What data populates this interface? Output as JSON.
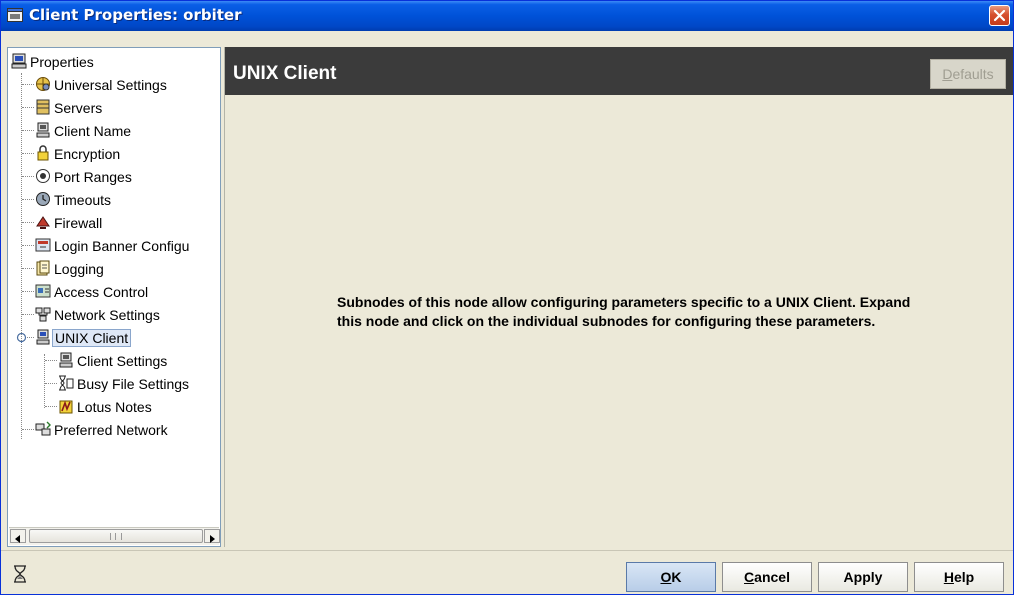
{
  "window": {
    "title": "Client Properties: orbiter",
    "close_icon": "close-icon"
  },
  "tree": {
    "root": {
      "label": "Properties",
      "icon": "computer-icon"
    },
    "items": [
      {
        "label": "Universal Settings",
        "icon": "settings-globe-icon"
      },
      {
        "label": "Servers",
        "icon": "server-icon"
      },
      {
        "label": "Client Name",
        "icon": "computer-icon"
      },
      {
        "label": "Encryption",
        "icon": "lock-icon"
      },
      {
        "label": "Port Ranges",
        "icon": "port-icon"
      },
      {
        "label": "Timeouts",
        "icon": "clock-icon"
      },
      {
        "label": "Firewall",
        "icon": "firewall-icon"
      },
      {
        "label": "Login Banner Configu",
        "icon": "banner-icon"
      },
      {
        "label": "Logging",
        "icon": "log-icon"
      },
      {
        "label": "Access Control",
        "icon": "access-control-icon"
      },
      {
        "label": "Network Settings",
        "icon": "network-icon"
      },
      {
        "label": "UNIX Client",
        "icon": "computer-icon",
        "selected": true,
        "children": [
          {
            "label": "Client Settings",
            "icon": "computer-icon"
          },
          {
            "label": "Busy File Settings",
            "icon": "hourglass-file-icon"
          },
          {
            "label": "Lotus Notes",
            "icon": "lotus-notes-icon"
          }
        ]
      },
      {
        "label": "Preferred Network",
        "icon": "preferred-network-icon"
      }
    ]
  },
  "main": {
    "header_title": "UNIX Client",
    "defaults_button": {
      "prefix": "",
      "mnemonic": "D",
      "rest": "efaults",
      "enabled": false
    },
    "description": "Subnodes of this node allow configuring parameters specific to a UNIX Client. Expand this node and click on the individual subnodes for configuring these parameters."
  },
  "buttons": {
    "ok": {
      "mnemonic": "O",
      "rest": "K"
    },
    "cancel": {
      "mnemonic": "C",
      "rest": "ancel"
    },
    "apply": {
      "label": "Apply"
    },
    "help": {
      "mnemonic": "H",
      "rest": "elp"
    }
  },
  "status": {
    "icon": "hourglass-icon"
  }
}
